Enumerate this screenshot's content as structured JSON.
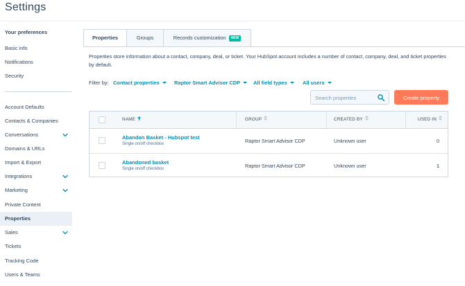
{
  "page": {
    "title": "Settings"
  },
  "sidebar": {
    "heading": "Your preferences",
    "items": [
      {
        "label": "Basic info",
        "chevron": false,
        "active": false
      },
      {
        "label": "Notifications",
        "chevron": false,
        "active": false
      },
      {
        "label": "Security",
        "chevron": false,
        "active": false
      },
      {
        "label": "Account Defaults",
        "chevron": false,
        "active": false
      },
      {
        "label": "Contacts & Companies",
        "chevron": false,
        "active": false
      },
      {
        "label": "Conversations",
        "chevron": true,
        "active": false
      },
      {
        "label": "Domains & URLs",
        "chevron": false,
        "active": false
      },
      {
        "label": "Import & Export",
        "chevron": false,
        "active": false
      },
      {
        "label": "Integrations",
        "chevron": true,
        "active": false
      },
      {
        "label": "Marketing",
        "chevron": true,
        "active": false
      },
      {
        "label": "Private Content",
        "chevron": false,
        "active": false
      },
      {
        "label": "Properties",
        "chevron": false,
        "active": true
      },
      {
        "label": "Sales",
        "chevron": true,
        "active": false
      },
      {
        "label": "Tickets",
        "chevron": false,
        "active": false
      },
      {
        "label": "Tracking Code",
        "chevron": false,
        "active": false
      },
      {
        "label": "Users & Teams",
        "chevron": false,
        "active": false
      }
    ]
  },
  "tabs": [
    {
      "label": "Properties",
      "active": true
    },
    {
      "label": "Groups",
      "active": false
    },
    {
      "label": "Records customization",
      "badge": "NEW",
      "active": false
    }
  ],
  "description": "Properties store information about a contact, company, deal, or ticket. Your HubSpot account includes a number of contact, company, deal, and ticket properties by default.",
  "filters": {
    "label": "Filter by:",
    "object": "Contact properties",
    "group": "Raptor Smart Advisor CDP",
    "field_type": "All field types",
    "users": "All users"
  },
  "search": {
    "placeholder": "Search properties"
  },
  "create_button": "Create property",
  "table": {
    "columns": {
      "name": "NAME",
      "group": "GROUP",
      "created_by": "CREATED BY",
      "used_in": "USED IN"
    },
    "rows": [
      {
        "name": "Abandon Basket - Hubspot test",
        "type": "Single on/off checkbox",
        "group": "Raptor Smart Advisor CDP",
        "created_by": "Unknown user",
        "used_in": "0"
      },
      {
        "name": "Abandoned basket",
        "type": "Single on/off checkbox",
        "group": "Raptor Smart Advisor CDP",
        "created_by": "Unknown user",
        "used_in": "1"
      }
    ]
  },
  "colors": {
    "accent": "#0091ae",
    "primary_button": "#ff7a59",
    "badge": "#00bda5",
    "text": "#33475b"
  }
}
